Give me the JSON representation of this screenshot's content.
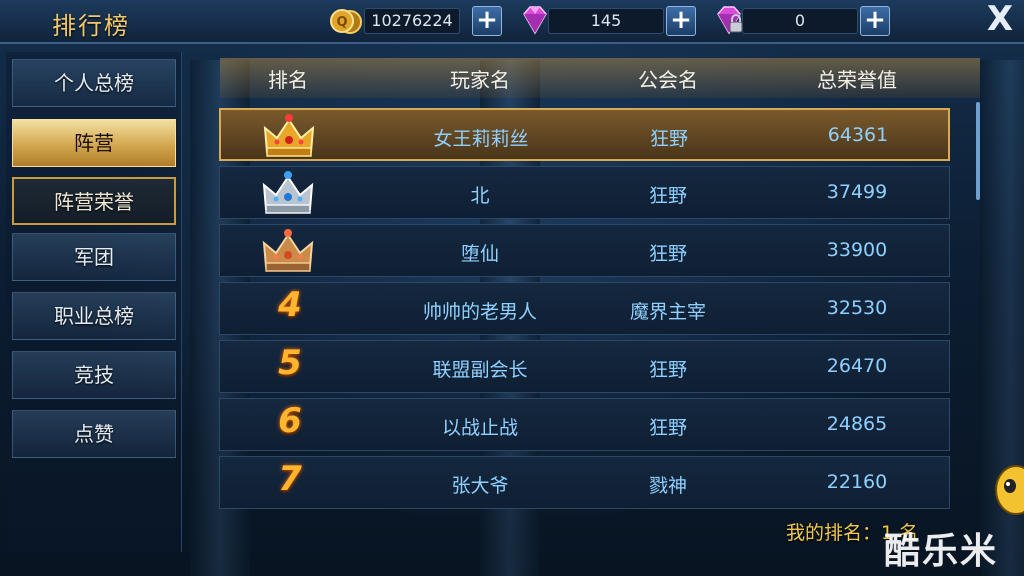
{
  "header": {
    "title": "排行榜",
    "gold": "10276224",
    "diamonds": "145",
    "locked_diamonds": "0",
    "close_label": "X"
  },
  "sidebar": {
    "items": [
      {
        "label": "个人总榜",
        "state": "normal"
      },
      {
        "label": "阵营",
        "state": "active"
      },
      {
        "label": "阵营荣誉",
        "state": "selected"
      },
      {
        "label": "军团",
        "state": "normal"
      },
      {
        "label": "职业总榜",
        "state": "normal"
      },
      {
        "label": "竞技",
        "state": "normal"
      },
      {
        "label": "点赞",
        "state": "normal"
      }
    ]
  },
  "table": {
    "columns": [
      "排名",
      "玩家名",
      "公会名",
      "总荣誉值"
    ],
    "rows": [
      {
        "rank": "1",
        "rank_icon": "gold-crown-icon",
        "player": "女王莉莉丝",
        "guild": "狂野",
        "honor": "64361"
      },
      {
        "rank": "2",
        "rank_icon": "silver-crown-icon",
        "player": "北",
        "guild": "狂野",
        "honor": "37499"
      },
      {
        "rank": "3",
        "rank_icon": "bronze-crown-icon",
        "player": "堕仙",
        "guild": "狂野",
        "honor": "33900"
      },
      {
        "rank": "4",
        "player": "帅帅的老男人",
        "guild": "魔界主宰",
        "honor": "32530"
      },
      {
        "rank": "5",
        "player": "联盟副会长",
        "guild": "狂野",
        "honor": "26470"
      },
      {
        "rank": "6",
        "player": "以战止战",
        "guild": "狂野",
        "honor": "24865"
      },
      {
        "rank": "7",
        "player": "张大爷",
        "guild": "戮神",
        "honor": "22160"
      }
    ]
  },
  "footer": {
    "my_rank": "我的排名：1 名",
    "watermark": "酷乐米"
  },
  "colors": {
    "accent_gold": "#f2c96c",
    "player_text": "#8fd0ff",
    "rank_number": "#ffb52e"
  }
}
